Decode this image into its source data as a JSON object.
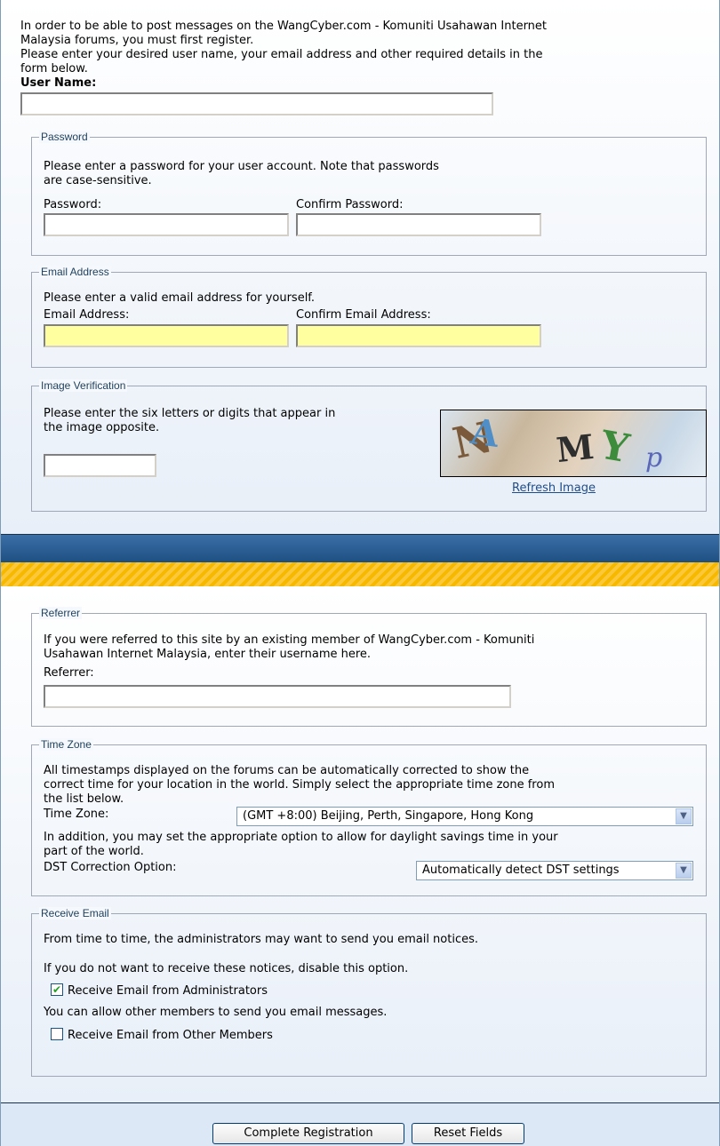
{
  "intro": {
    "line1": "In order to be able to post messages on the WangCyber.com - Komuniti Usahawan Internet",
    "line2": "Malaysia forums, you must first register.",
    "line3": "Please enter your desired user name, your email address and other required details in the",
    "line4": "form below."
  },
  "username": {
    "label": "User Name:",
    "value": ""
  },
  "password_section": {
    "legend": "Password",
    "help_line1": "Please enter a password for your user account. Note that passwords",
    "help_line2": "are case-sensitive.",
    "password_label": "Password:",
    "confirm_label": "Confirm Password:"
  },
  "email_section": {
    "legend": "Email Address",
    "help": "Please enter a valid email address for yourself.",
    "email_label": "Email Address:",
    "confirm_label": "Confirm Email Address:"
  },
  "verification_section": {
    "legend": "Image Verification",
    "help_line1": "Please enter the six letters or digits that appear in",
    "help_line2": "the image opposite.",
    "refresh_link": "Refresh Image"
  },
  "referrer_section": {
    "legend": "Referrer",
    "help_line1": "If you were referred to this site by an existing member of WangCyber.com - Komuniti",
    "help_line2": "Usahawan Internet Malaysia, enter their username here.",
    "label": "Referrer:"
  },
  "timezone_section": {
    "legend": "Time Zone",
    "help_line1": "All timestamps displayed on the forums can be automatically corrected to show the",
    "help_line2": "correct time for your location in the world. Simply select the appropriate time zone from",
    "help_line3": "the list below.",
    "tz_label": "Time Zone:",
    "tz_selected": "(GMT +8:00) Beijing, Perth, Singapore, Hong Kong",
    "dst_help_line1": "In addition, you may set the appropriate option to allow for daylight savings time in your",
    "dst_help_line2": "part of the world.",
    "dst_label": "DST Correction Option:",
    "dst_selected": "Automatically detect DST settings"
  },
  "email_options_section": {
    "legend": "Receive Email",
    "help1": "From time to time, the administrators may want to send you email notices.",
    "help2": "If you do not want to receive these notices, disable this option.",
    "admin_checkbox_label": "Receive Email from Administrators",
    "admin_checked": true,
    "help3": "You can allow other members to send you email messages.",
    "members_checkbox_label": "Receive Email from Other Members",
    "members_checked": false
  },
  "buttons": {
    "submit": "Complete Registration",
    "reset": "Reset Fields"
  },
  "colors": {
    "header_bar": "#1e4f82",
    "stripe_bar": "#f7b900",
    "legend_text": "#22425e",
    "highlight_input": "#ffffa0"
  }
}
